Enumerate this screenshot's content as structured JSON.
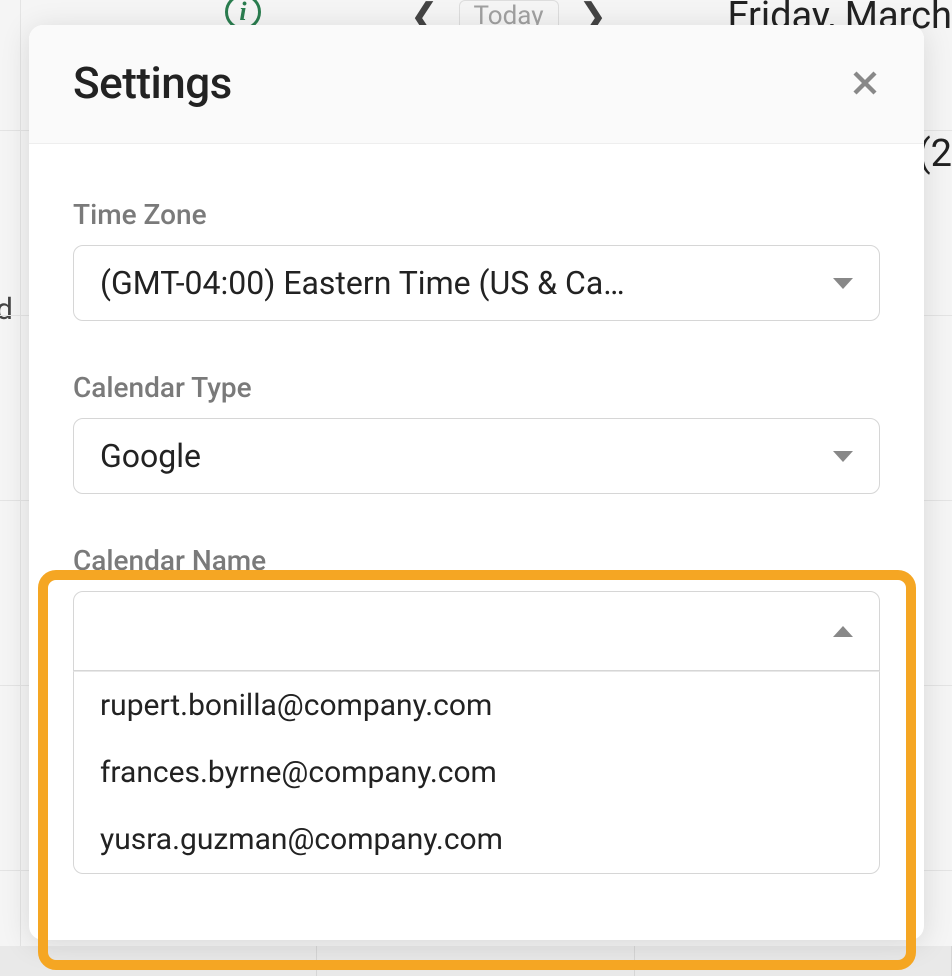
{
  "background": {
    "date_partial": "Friday, March",
    "today_label": "Today",
    "d_fragment": "d",
    "paren_fragment": "(2"
  },
  "modal": {
    "title": "Settings",
    "fields": {
      "timezone": {
        "label": "Time Zone",
        "value": "(GMT-04:00) Eastern Time (US & Ca…"
      },
      "calendar_type": {
        "label": "Calendar Type",
        "value": "Google"
      },
      "calendar_name": {
        "label": "Calendar Name",
        "value": "",
        "options": [
          "rupert.bonilla@company.com",
          "frances.byrne@company.com",
          "yusra.guzman@company.com"
        ]
      }
    }
  }
}
